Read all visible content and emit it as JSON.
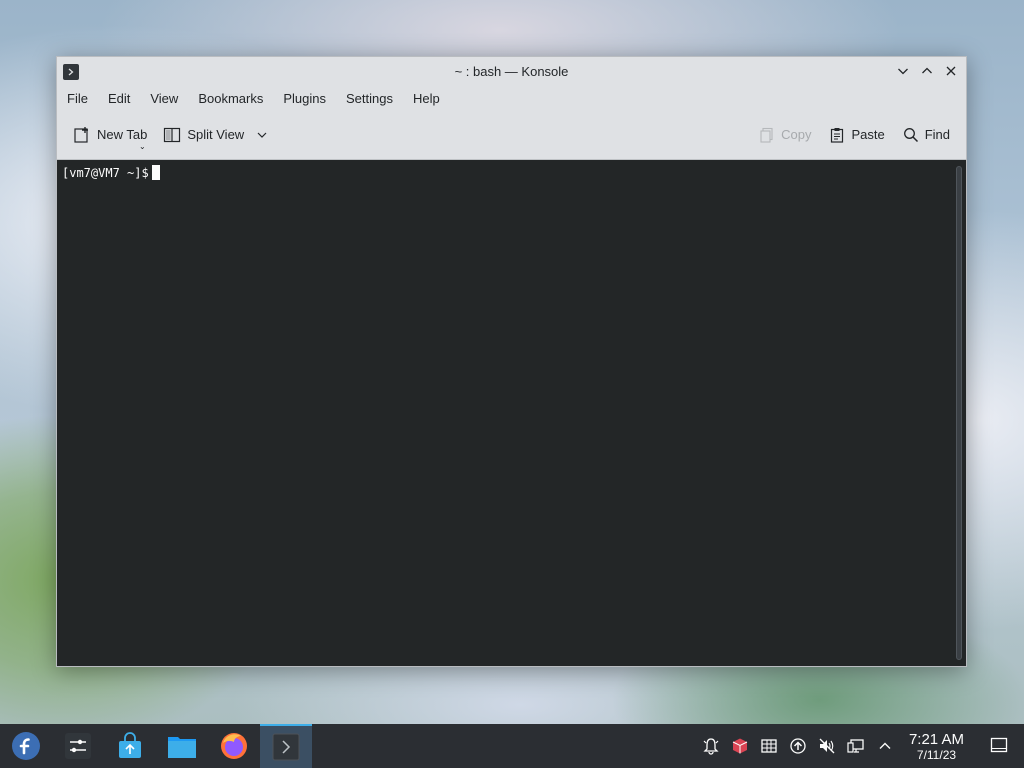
{
  "window": {
    "title": "~ : bash — Konsole"
  },
  "menubar": {
    "items": [
      "File",
      "Edit",
      "View",
      "Bookmarks",
      "Plugins",
      "Settings",
      "Help"
    ]
  },
  "toolbar": {
    "new_tab": "New Tab",
    "split_view": "Split View",
    "copy": "Copy",
    "paste": "Paste",
    "find": "Find"
  },
  "terminal": {
    "prompt": "[vm7@VM7 ~]$"
  },
  "taskbar": {
    "time": "7:21 AM",
    "date": "7/11/23",
    "apps": [
      "fedora-launcher",
      "system-settings",
      "software-center",
      "file-manager",
      "firefox",
      "konsole"
    ],
    "tray": [
      "notifications-icon",
      "package-icon",
      "clipboard-icon",
      "updates-icon",
      "volume-muted-icon",
      "network-icon",
      "expand-tray-icon"
    ]
  },
  "colors": {
    "terminal_bg": "#232627",
    "accent": "#3daee9",
    "window_bg": "#dfe1e4",
    "taskbar_bg": "#2b2e33"
  }
}
